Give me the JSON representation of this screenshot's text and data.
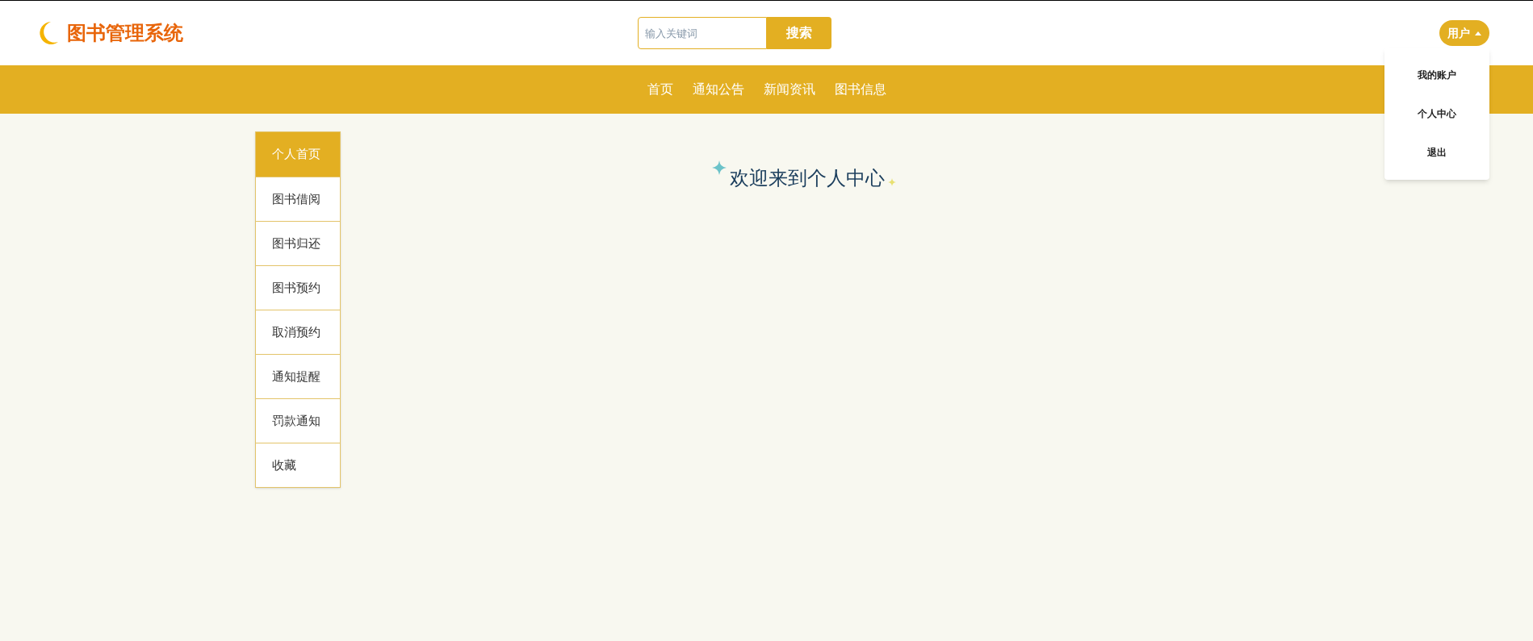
{
  "header": {
    "title": "图书管理系统",
    "search": {
      "placeholder": "输入关键词",
      "button": "搜索"
    },
    "user_menu": {
      "label": "用户",
      "expanded": true,
      "items": [
        "我的账户",
        "个人中心",
        "退出"
      ]
    }
  },
  "nav": [
    "首页",
    "通知公告",
    "新闻资讯",
    "图书信息"
  ],
  "sidebar": {
    "items": [
      {
        "label": "个人首页",
        "selected": true
      },
      {
        "label": "图书借阅",
        "selected": false
      },
      {
        "label": "图书归还",
        "selected": false
      },
      {
        "label": "图书预约",
        "selected": false
      },
      {
        "label": "取消预约",
        "selected": false
      },
      {
        "label": "通知提醒",
        "selected": false
      },
      {
        "label": "罚款通知",
        "selected": false
      },
      {
        "label": "收藏",
        "selected": false
      }
    ]
  },
  "main": {
    "title": "欢迎来到个人中心"
  }
}
